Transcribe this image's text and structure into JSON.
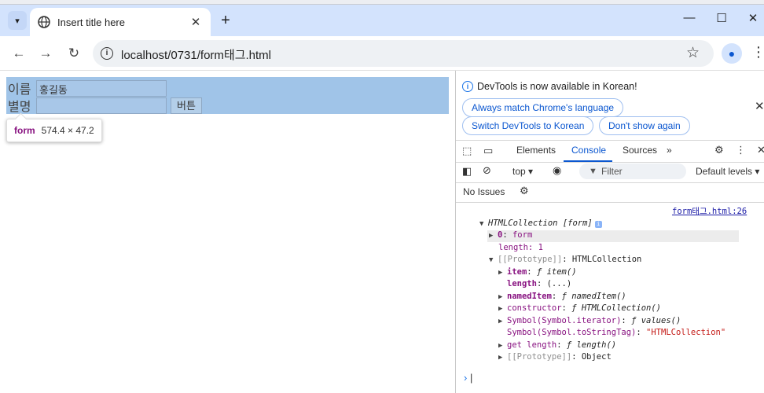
{
  "browser": {
    "tab": {
      "title": "Insert title here"
    },
    "url": "localhost/0731/form태그.html"
  },
  "page": {
    "form": {
      "row1": {
        "label": "이름",
        "value": "홍길동"
      },
      "row2": {
        "label": "별명",
        "value": "",
        "button": "버튼"
      }
    },
    "tooltip": {
      "tag": "form",
      "size": "574.4 × 47.2"
    }
  },
  "devtools": {
    "notice": "DevTools is now available in Korean!",
    "actions": [
      "Always match Chrome's language",
      "Switch DevTools to Korean",
      "Don't show again"
    ],
    "tabs": [
      "Elements",
      "Console",
      "Sources"
    ],
    "active_tab": "Console",
    "context": "top",
    "filter_placeholder": "Filter",
    "levels": "Default levels",
    "issues": "No Issues",
    "console": {
      "source": "form태그.html:26",
      "header": "HTMLCollection [form]",
      "item0_key": "0",
      "item0_val": "form",
      "length_line": "length: 1",
      "proto_key": "[[Prototype]]",
      "proto_val": "HTMLCollection",
      "props": [
        {
          "key": "item",
          "val": "ƒ item()"
        },
        {
          "key": "length",
          "val": "(...)"
        },
        {
          "key": "namedItem",
          "val": "ƒ namedItem()"
        },
        {
          "key": "constructor",
          "val": "ƒ HTMLCollection()"
        },
        {
          "key": "Symbol(Symbol.iterator)",
          "val": "ƒ values()"
        },
        {
          "key": "Symbol(Symbol.toStringTag)",
          "val": "\"HTMLCollection\""
        },
        {
          "key": "get length",
          "val": "ƒ length()"
        },
        {
          "key": "[[Prototype]]",
          "val": "Object"
        }
      ]
    }
  }
}
